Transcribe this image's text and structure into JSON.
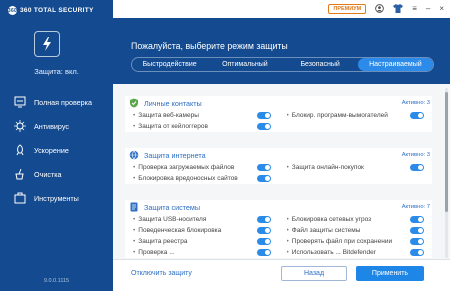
{
  "app": {
    "brand": "360 TOTAL SECURITY",
    "brand_badge": "360",
    "protection_status": "Защита: вкл.",
    "version": "9.0.0.1115"
  },
  "topbar": {
    "premium_label": "ПРЕМИУМ",
    "icons": [
      "user-icon",
      "shirt-icon",
      "menu-icon",
      "minimize-icon",
      "close-icon"
    ]
  },
  "sidebar": {
    "items": [
      {
        "label": "Полная проверка",
        "icon": "scan-icon"
      },
      {
        "label": "Антивирус",
        "icon": "antivirus-icon"
      },
      {
        "label": "Ускорение",
        "icon": "rocket-icon"
      },
      {
        "label": "Очистка",
        "icon": "cleanup-icon"
      },
      {
        "label": "Инструменты",
        "icon": "tools-icon"
      }
    ]
  },
  "header": {
    "title": "Пожалуйста, выберите режим защиты",
    "modes": [
      "Быстродействие",
      "Оптимальный",
      "Безопасный",
      "Настраиваемый"
    ],
    "active_mode": "Настраиваемый"
  },
  "sections": [
    {
      "title": "Личные контакты",
      "status": "Активно: 3",
      "items": [
        [
          "Защита веб-камеры",
          "Блокир. программ-вымогателей"
        ],
        [
          "Защита от кейлоггеров",
          ""
        ]
      ]
    },
    {
      "title": "Защита интернета",
      "status": "Активно: 3",
      "items": [
        [
          "Проверка загружаемых файлов",
          "Защита онлайн-покупок"
        ],
        [
          "Блокировка вредоносных сайтов",
          ""
        ]
      ]
    },
    {
      "title": "Защита системы",
      "status": "Активно: 7",
      "items": [
        [
          "Защита USB-носителя",
          "Блокировка сетевых угроз"
        ],
        [
          "Поведенческая блокировка",
          "Файл защиты системы"
        ],
        [
          "Защита реестра",
          "Проверять файл при сохранении"
        ],
        [
          "Проверка ...",
          "Использовать ... Bitdefender"
        ]
      ]
    }
  ],
  "footer": {
    "disable_link": "Отключить защиту",
    "back_label": "Назад",
    "apply_label": "Применить"
  },
  "colors": {
    "sidebar": "#144a8f",
    "accent": "#2c8be8",
    "premium": "#e07a1a",
    "section_title": "#2d6fc4"
  }
}
